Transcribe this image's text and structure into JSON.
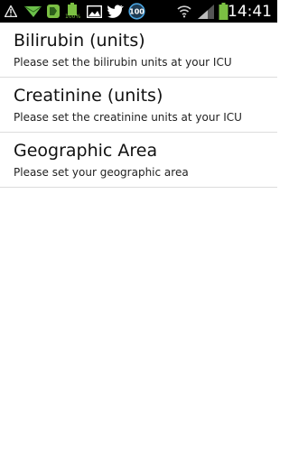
{
  "status_bar": {
    "time": "14:41",
    "battery_percent_label": "100%",
    "notification_badge": "100",
    "icons": [
      "warning-icon",
      "mail-arrow-icon",
      "evernote-icon",
      "battery-full-icon",
      "image-icon",
      "twitter-icon",
      "hundred-badge-icon",
      "wifi-icon",
      "signal-icon",
      "battery-icon"
    ],
    "colors": {
      "background": "#000000",
      "accent_green": "#7bc043"
    }
  },
  "preferences": [
    {
      "title": "Bilirubin (units)",
      "summary": "Please set the bilirubin units at your ICU"
    },
    {
      "title": "Creatinine (units)",
      "summary": "Please set the creatinine units at your ICU"
    },
    {
      "title": "Geographic Area",
      "summary": "Please set your geographic area"
    }
  ]
}
